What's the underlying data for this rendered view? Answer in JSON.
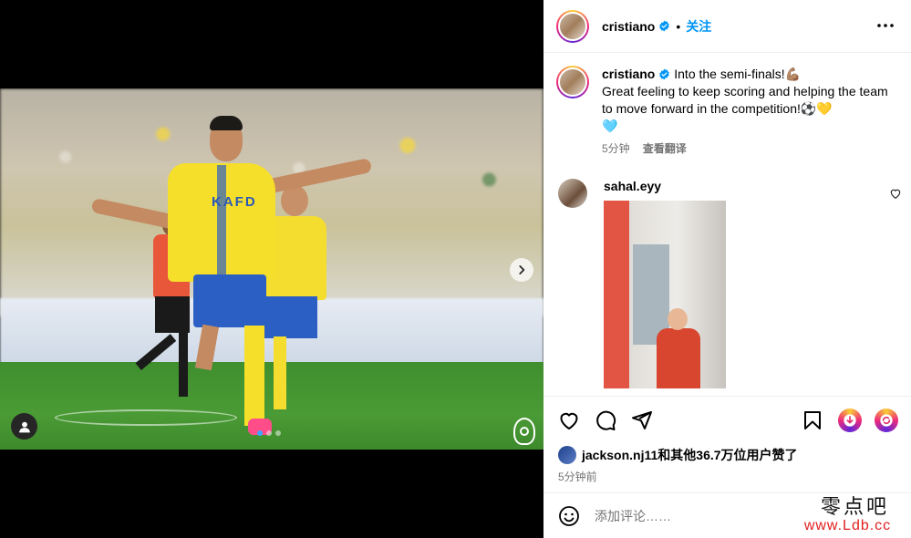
{
  "post": {
    "author": "cristiano",
    "verified": true,
    "separator": "•",
    "follow_label": "关注",
    "caption_line1": "Into the semi-finals!💪🏽",
    "caption_line2": "Great feeling to keep scoring and helping the team to move forward in the competition!⚽💛",
    "caption_line3": "🩵",
    "caption_time": "5分钟",
    "translate_label": "查看翻译",
    "media": {
      "jersey_text": "KAFD",
      "carousel_dots": 3,
      "active_dot": 1
    }
  },
  "comments": [
    {
      "username": "sahal.eyy",
      "has_gif": true
    }
  ],
  "likes": {
    "username": "jackson.nj11",
    "text": "和其他36.7万位用户赞了"
  },
  "post_time": "5分钟前",
  "comment_input": {
    "placeholder": "添加评论……",
    "value": ""
  },
  "icons": {
    "like": "heart-icon",
    "comment": "comment-icon",
    "share": "share-icon",
    "save": "bookmark-icon",
    "more": "more-icon",
    "emoji": "emoji-icon"
  },
  "colors": {
    "follow": "#0095f6",
    "verified": "#0095f6",
    "text_secondary": "#737373",
    "divider": "#efefef"
  },
  "watermark": {
    "top": "零点吧",
    "bottom": "www.Ldb.cc"
  }
}
